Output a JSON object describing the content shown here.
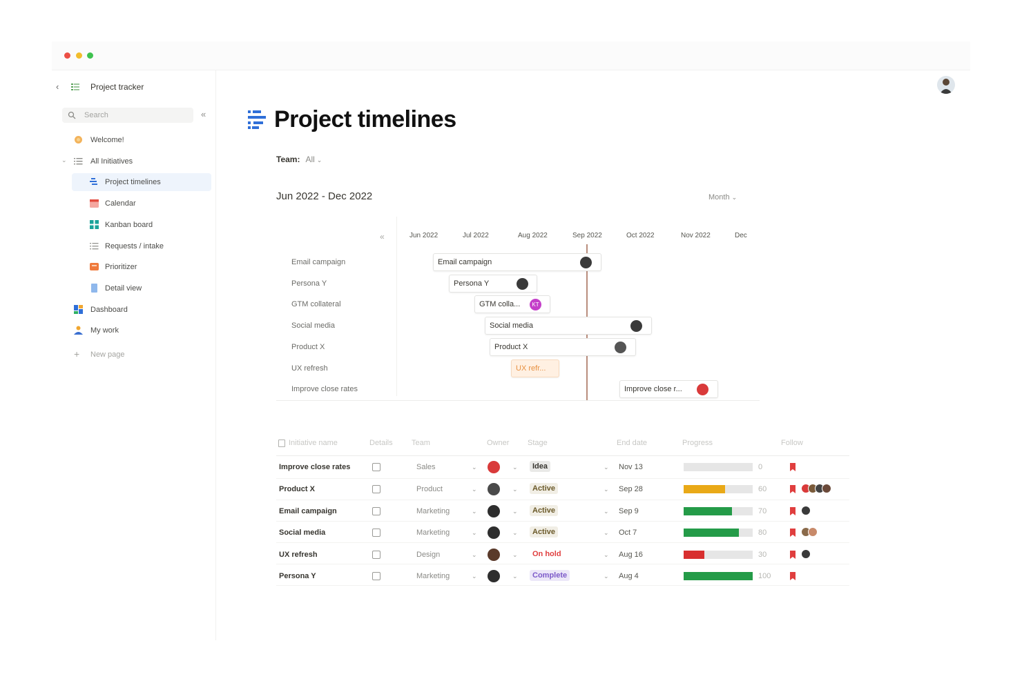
{
  "window": {
    "traffic_lights": [
      "close",
      "minimize",
      "maximize"
    ]
  },
  "sidebar": {
    "breadcrumb": "Project tracker",
    "search_placeholder": "Search",
    "items": [
      {
        "label": "Welcome!",
        "icon": "welcome-icon"
      },
      {
        "label": "All Initiatives",
        "icon": "list-icon"
      },
      {
        "label": "Project timelines",
        "icon": "timeline-icon"
      },
      {
        "label": "Calendar",
        "icon": "calendar-icon"
      },
      {
        "label": "Kanban board",
        "icon": "kanban-icon"
      },
      {
        "label": "Requests / intake",
        "icon": "requests-icon"
      },
      {
        "label": "Prioritizer",
        "icon": "prioritizer-icon"
      },
      {
        "label": "Detail view",
        "icon": "detail-icon"
      },
      {
        "label": "Dashboard",
        "icon": "dashboard-icon"
      },
      {
        "label": "My work",
        "icon": "person-icon"
      },
      {
        "label": "New page",
        "icon": "plus-icon"
      }
    ]
  },
  "page": {
    "title": "Project timelines",
    "team_label": "Team:",
    "team_value": "All",
    "date_range": "Jun 2022 - Dec 2022",
    "view_mode": "Month"
  },
  "timeline": {
    "months": [
      "Jun 2022",
      "Jul 2022",
      "Aug 2022",
      "Sep 2022",
      "Oct 2022",
      "Nov 2022",
      "Dec"
    ],
    "rows": [
      {
        "label": "Email campaign",
        "bar": "Email campaign"
      },
      {
        "label": "Persona Y",
        "bar": "Persona Y"
      },
      {
        "label": "GTM collateral",
        "bar": "GTM colla...",
        "avatar_initials": "KT"
      },
      {
        "label": "Social media",
        "bar": "Social media"
      },
      {
        "label": "Product X",
        "bar": "Product X"
      },
      {
        "label": "UX refresh",
        "bar": "UX refr..."
      },
      {
        "label": "Improve close rates",
        "bar": "Improve close r..."
      }
    ]
  },
  "table": {
    "headers": [
      "Initiative name",
      "Details",
      "Team",
      "Owner",
      "Stage",
      "End date",
      "Progress",
      "Follow"
    ],
    "rows": [
      {
        "name": "Improve close rates",
        "team": "Sales",
        "stage": "Idea",
        "end": "Nov 13",
        "progress": 0
      },
      {
        "name": "Product X",
        "team": "Product",
        "stage": "Active",
        "end": "Sep 28",
        "progress": 60
      },
      {
        "name": "Email campaign",
        "team": "Marketing",
        "stage": "Active",
        "end": "Sep 9",
        "progress": 70
      },
      {
        "name": "Social media",
        "team": "Marketing",
        "stage": "Active",
        "end": "Oct 7",
        "progress": 80
      },
      {
        "name": "UX refresh",
        "team": "Design",
        "stage": "On hold",
        "end": "Aug 16",
        "progress": 30
      },
      {
        "name": "Persona Y",
        "team": "Marketing",
        "stage": "Complete",
        "end": "Aug 4",
        "progress": 100
      }
    ]
  },
  "colors": {
    "progress_yellow": "#e9a917",
    "progress_green": "#249b48",
    "progress_red": "#d82f2f",
    "stage_idea_bg": "#e9e9e7",
    "stage_active_bg": "#f1eee5",
    "stage_onhold_text": "#e03e3e",
    "stage_complete_bg": "#ece7f8",
    "stage_complete_text": "#7c5ac9",
    "today_line": "#b98d7c"
  }
}
